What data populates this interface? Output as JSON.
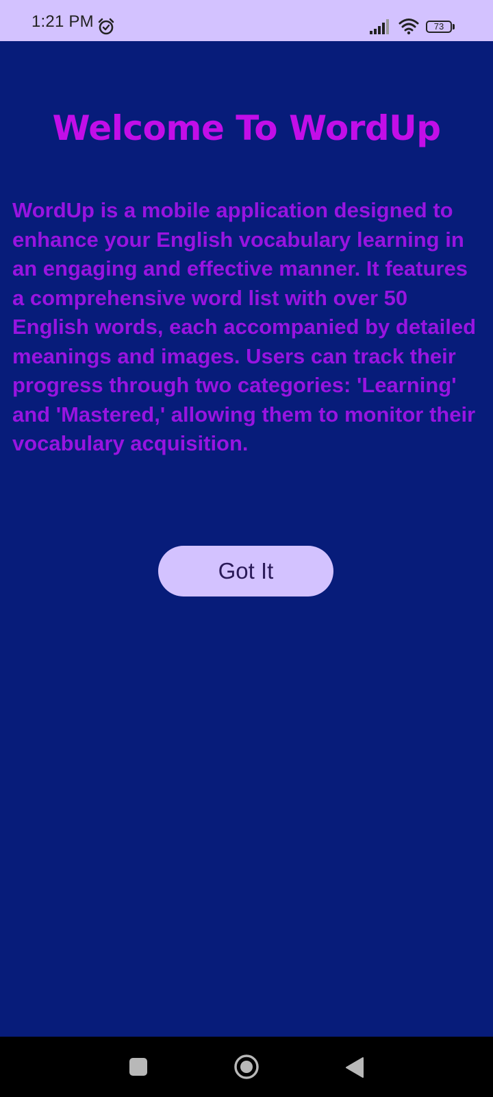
{
  "status_bar": {
    "time": "1:21 PM",
    "battery_level": "73",
    "icons": [
      "alarm-icon",
      "signal-icon",
      "wifi-icon",
      "battery-icon"
    ]
  },
  "main": {
    "title": "Welcome To WordUp",
    "description": "WordUp is a mobile application designed to enhance your English vocabulary learning in an engaging and effective manner. It features a comprehensive word list with over 50 English words, each accompanied by detailed meanings and images. Users can track their progress through two categories: 'Learning' and 'Mastered,' allowing them to monitor their vocabulary acquisition.",
    "got_it_label": "Got It"
  },
  "nav_bar": {
    "icons": [
      "recents-icon",
      "home-icon",
      "back-icon"
    ]
  },
  "colors": {
    "background": "#071c7a",
    "status_bar": "#d3c2ff",
    "title": "#c20ee8",
    "description": "#9814e0",
    "button": "#d3c2ff",
    "button_text": "#2a1a58"
  }
}
